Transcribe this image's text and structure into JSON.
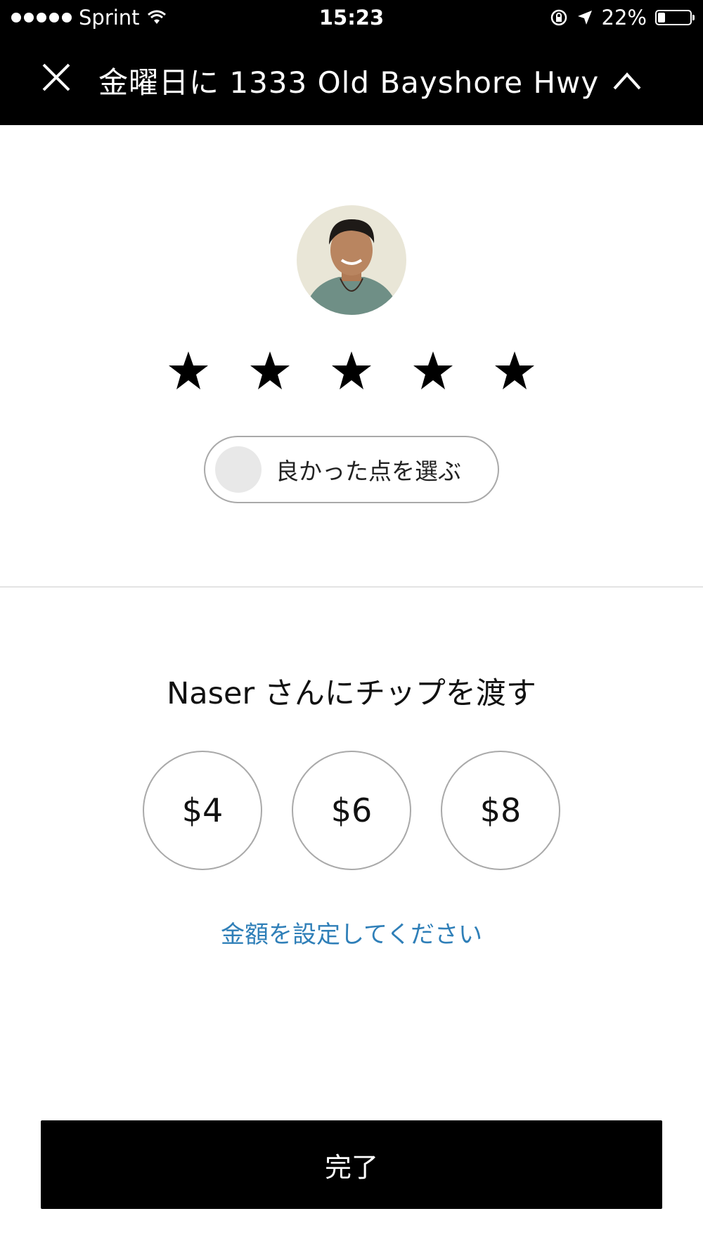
{
  "status_bar": {
    "carrier": "Sprint",
    "time": "15:23",
    "battery": "22%",
    "battery_level": 0.22,
    "icons": [
      "signal-dots-icon",
      "wifi-icon",
      "rotation-lock-icon",
      "location-arrow-icon",
      "battery-icon"
    ]
  },
  "header": {
    "title": "金曜日に 1333 Old Bayshore Hwy",
    "close_icon": "close-icon",
    "expand_icon": "chevron-up-icon"
  },
  "rating": {
    "stars_selected": 5,
    "stars_total": 5,
    "compliment_label": "良かった点を選ぶ"
  },
  "tip": {
    "heading": "Naser さんにチップを渡す",
    "options": [
      "$4",
      "$6",
      "$8"
    ],
    "custom_label": "金額を設定してください"
  },
  "footer": {
    "done_label": "完了"
  },
  "colors": {
    "accent_link": "#2f7fb8",
    "primary": "#000000",
    "border": "#a9a9a9"
  }
}
